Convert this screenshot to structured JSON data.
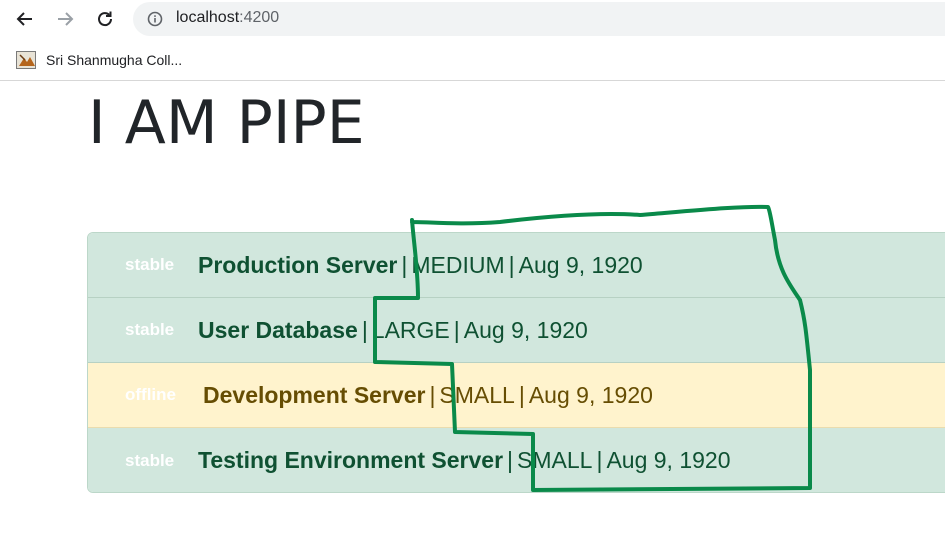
{
  "browser": {
    "url_host": "localhost",
    "url_port": ":4200",
    "bookmark_label": "Sri Shanmugha Coll..."
  },
  "page": {
    "title": "I AM PIPE"
  },
  "servers": [
    {
      "status": "stable",
      "name": "Production Server",
      "size": "MEDIUM",
      "date": "Aug 9, 1920",
      "variant": "success"
    },
    {
      "status": "stable",
      "name": "User Database",
      "size": "LARGE",
      "date": "Aug 9, 1920",
      "variant": "success"
    },
    {
      "status": "offline",
      "name": "Development Server",
      "size": "SMALL",
      "date": "Aug 9, 1920",
      "variant": "warning"
    },
    {
      "status": "stable",
      "name": "Testing Environment Server",
      "size": "SMALL",
      "date": "Aug 9, 1920",
      "variant": "success"
    }
  ],
  "separator": "|",
  "colors": {
    "success_bg": "#d1e7dd",
    "success_text": "#0f5132",
    "warning_bg": "#fff3cd",
    "warning_text": "#664d03",
    "annotation_stroke": "#0a8a4a"
  }
}
